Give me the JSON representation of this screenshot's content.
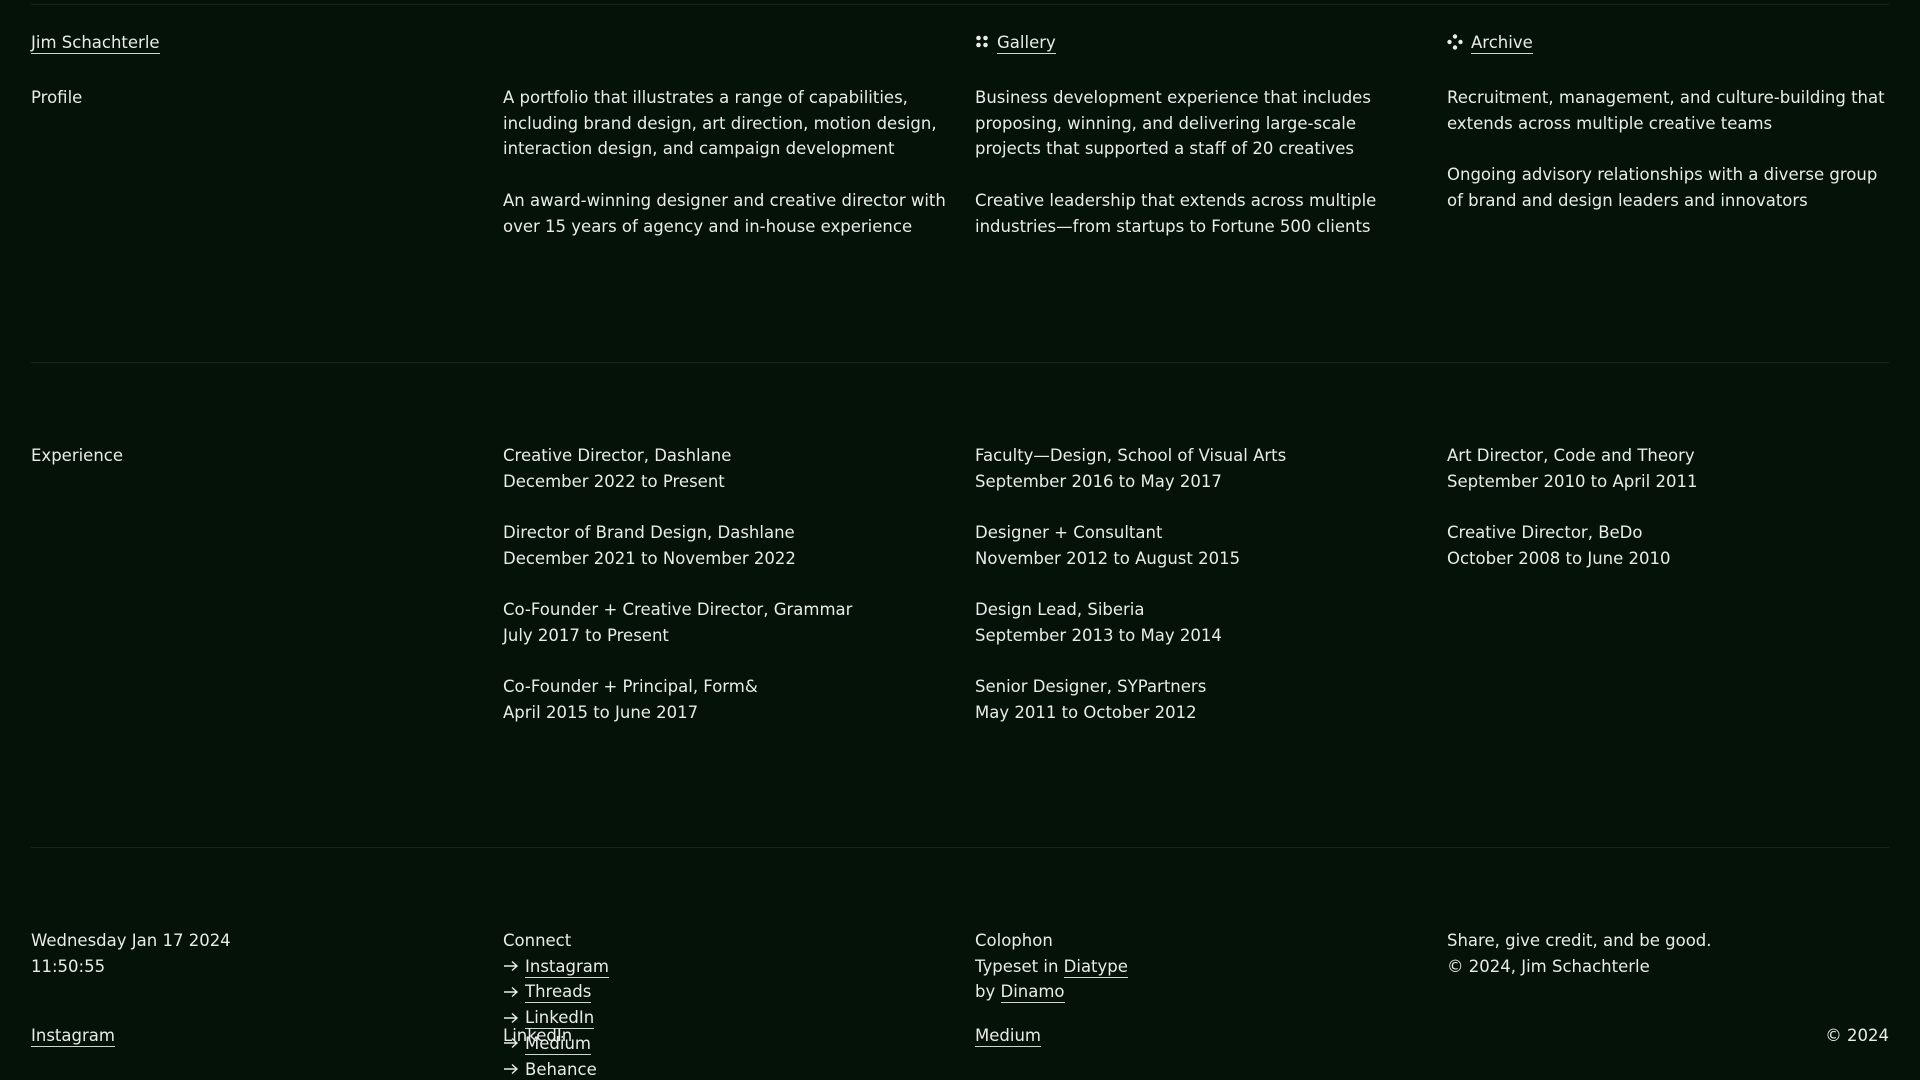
{
  "nav": {
    "name": "Jim Schachterle",
    "gallery": "Gallery",
    "archive": "Archive"
  },
  "profile": {
    "label": "Profile",
    "col1": [
      "A portfolio that illustrates a range of capabilities, including brand design, art direction, motion design, interaction design, and campaign development",
      "An award-winning designer and creative director with over 15 years of agency and in-house experience"
    ],
    "col2": [
      "Business development experience that includes proposing, winning, and delivering large-scale projects that supported a staff of 20 creatives",
      "Creative leadership that extends across multiple industries—from startups to Fortune 500 clients"
    ],
    "col3": [
      "Recruitment, management, and culture-building that extends across multiple creative teams",
      "Ongoing advisory relationships with a diverse group of brand and design leaders and innovators"
    ]
  },
  "experience": {
    "label": "Experience",
    "col1": [
      {
        "role": "Creative Director, Dashlane",
        "dates": "December 2022 to Present"
      },
      {
        "role": "Director of Brand Design, Dashlane",
        "dates": "December 2021 to November 2022"
      },
      {
        "role": "Co-Founder + Creative Director, Grammar",
        "dates": "July 2017 to Present"
      },
      {
        "role": "Co-Founder + Principal, Form&",
        "dates": "April 2015 to June 2017"
      }
    ],
    "col2": [
      {
        "role": "Faculty—Design, School of Visual Arts",
        "dates": "September 2016 to May 2017"
      },
      {
        "role": "Designer + Consultant",
        "dates": "November 2012 to August 2015"
      },
      {
        "role": "Design Lead, Siberia",
        "dates": "September 2013 to May 2014"
      },
      {
        "role": "Senior Designer, SYPartners",
        "dates": "May 2011 to October 2012"
      }
    ],
    "col3": [
      {
        "role": "Art Director, Code and Theory",
        "dates": "September 2010 to April 2011"
      },
      {
        "role": "Creative Director, BeDo",
        "dates": "October 2008 to June 2010"
      }
    ]
  },
  "footer": {
    "date": "Wednesday Jan 17 2024",
    "time": "11:50:55",
    "connect_title": "Connect",
    "connect_links": [
      "Instagram",
      "Threads",
      "LinkedIn",
      "Medium",
      "Behance"
    ],
    "colophon_title": "Colophon",
    "typeset_prefix": "Typeset in",
    "typeface": "Diatype",
    "by_prefix": "by",
    "foundry": "Dinamo",
    "share_line": "Share, give credit, and be good.",
    "copyright_line": "© 2024, Jim Schachterle"
  },
  "bottom_bar": {
    "instagram": "Instagram",
    "linkedin": "LinkedIn",
    "medium": "Medium",
    "copyright": "© 2024"
  },
  "icons": {
    "gallery": "four-dots-grid-icon",
    "archive": "scatter-dots-icon",
    "arrow": "arrow-right-icon"
  }
}
